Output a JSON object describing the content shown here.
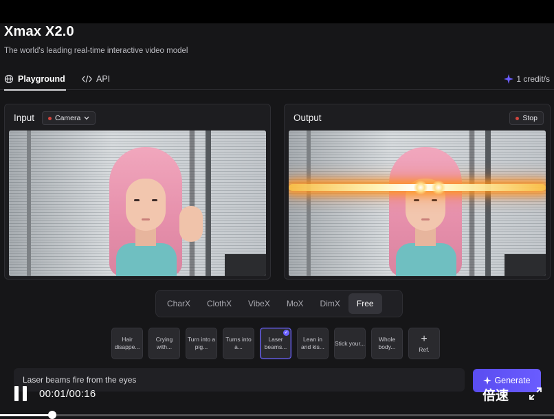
{
  "app": {
    "title": "Xmax X2.0",
    "subtitle": "The world's leading real-time interactive video model"
  },
  "tabs": [
    {
      "label": "Playground",
      "icon": "globe-icon",
      "active": true
    },
    {
      "label": "API",
      "icon": "code-icon",
      "active": false
    }
  ],
  "credits": {
    "label": "1 credit/s",
    "icon": "sparkle-icon"
  },
  "input_panel": {
    "label": "Input",
    "source": "Camera"
  },
  "output_panel": {
    "label": "Output",
    "stop_label": "Stop"
  },
  "modes": [
    {
      "label": "CharX",
      "active": false
    },
    {
      "label": "ClothX",
      "active": false
    },
    {
      "label": "VibeX",
      "active": false
    },
    {
      "label": "MoX",
      "active": false
    },
    {
      "label": "DimX",
      "active": false
    },
    {
      "label": "Free",
      "active": true
    }
  ],
  "presets": [
    {
      "label": "Hair disappe...",
      "active": false
    },
    {
      "label": "Crying with...",
      "active": false
    },
    {
      "label": "Turn into a pig...",
      "active": false
    },
    {
      "label": "Turns into a...",
      "active": false
    },
    {
      "label": "Laser beams...",
      "active": true
    },
    {
      "label": "Lean in and kis...",
      "active": false
    },
    {
      "label": "Stick your...",
      "active": false
    },
    {
      "label": "Whole body...",
      "active": false
    }
  ],
  "ref_label": "Ref.",
  "prompt": {
    "value": "Laser beams fire from the eyes"
  },
  "generate_label": "Generate",
  "player": {
    "time": "00:01/00:16",
    "speed_label": "倍速",
    "progress": 0.094
  },
  "colors": {
    "accent": "#6a5cff",
    "recording_dot": "#d2453d",
    "background": "#161618"
  }
}
